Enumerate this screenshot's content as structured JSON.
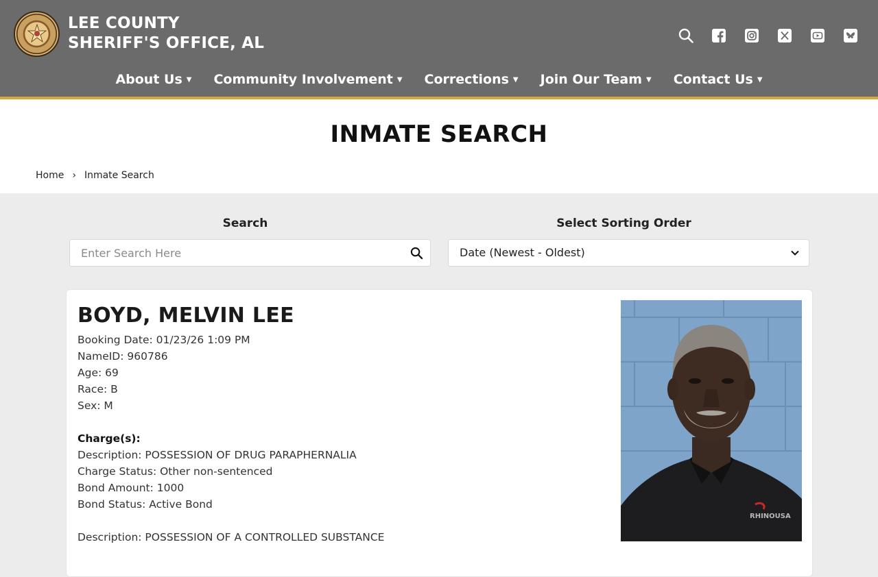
{
  "header": {
    "title_line1": "LEE COUNTY",
    "title_line2": "SHERIFF'S OFFICE, AL",
    "icons": [
      "search-icon",
      "facebook-icon",
      "instagram-icon",
      "x-icon",
      "youtube-icon",
      "bluesky-icon"
    ]
  },
  "nav": {
    "items": [
      {
        "label": "About Us"
      },
      {
        "label": "Community Involvement"
      },
      {
        "label": "Corrections"
      },
      {
        "label": "Join Our Team"
      },
      {
        "label": "Contact Us"
      }
    ],
    "caret": "▼"
  },
  "page": {
    "title": "INMATE SEARCH",
    "breadcrumb": {
      "home": "Home",
      "separator": "›",
      "current": "Inmate Search"
    }
  },
  "controls": {
    "search_label": "Search",
    "search_placeholder": "Enter Search Here",
    "sort_label": "Select Sorting Order",
    "sort_value": "Date (Newest - Oldest)"
  },
  "inmate": {
    "name": "BOYD, MELVIN LEE",
    "booking_date": "Booking Date: 01/23/26 1:09 PM",
    "name_id": "NameID: 960786",
    "age": "Age: 69",
    "race": "Race: B",
    "sex": "Sex: M",
    "charges_heading": "Charge(s):",
    "charges": [
      {
        "description": "Description: POSSESSION OF DRUG PARAPHERNALIA",
        "status": "Charge Status: Other non-sentenced",
        "bond_amount": "Bond Amount: 1000",
        "bond_status": "Bond Status: Active Bond"
      },
      {
        "description": "Description: POSSESSION OF A CONTROLLED SUBSTANCE"
      }
    ]
  },
  "colors": {
    "header_bg": "#6b6b6b",
    "accent_gold": "#d4a93c",
    "page_bg": "#ececec"
  }
}
